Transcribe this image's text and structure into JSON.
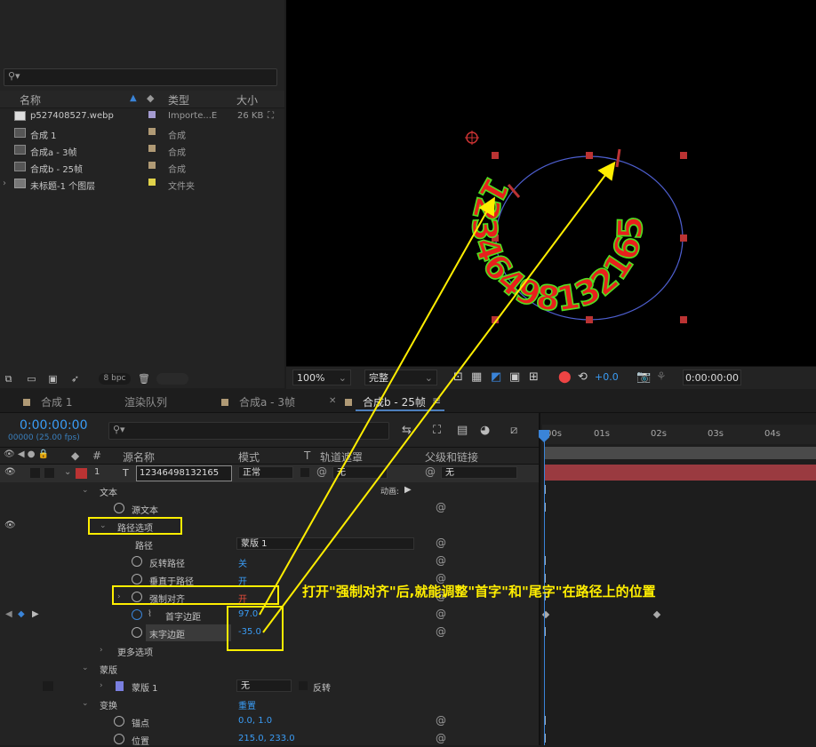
{
  "project": {
    "columns": {
      "name": "名称",
      "type": "类型",
      "size": "大小"
    },
    "items": [
      {
        "name": "p527408527.webp",
        "type": "Importe...E",
        "size": "26 KB",
        "swatch": "#a49bd0"
      },
      {
        "name": "合成 1",
        "type": "合成",
        "size": "",
        "swatch": "#b09a75"
      },
      {
        "name": "合成a - 3帧",
        "type": "合成",
        "size": "",
        "swatch": "#b09a75"
      },
      {
        "name": "合成b - 25帧",
        "type": "合成",
        "size": "",
        "swatch": "#b09a75"
      },
      {
        "name": "未标题-1 个图层",
        "type": "文件夹",
        "size": "",
        "swatch": "#e0d24a"
      }
    ],
    "bpc": "8 bpc"
  },
  "viewer": {
    "path_text": "12346498132165",
    "zoom": "100%",
    "quality": "完整",
    "exposure": "+0.0",
    "timecode": "0:00:00:00"
  },
  "tabs": [
    {
      "label": "合成 1"
    },
    {
      "label": "渲染队列"
    },
    {
      "label": "合成a - 3帧"
    },
    {
      "label": "合成b - 25帧"
    }
  ],
  "timeline": {
    "timecode": "0:00:00:00",
    "fps": "00000 (25.00 fps)",
    "columns": {
      "num": "#",
      "source": "源名称",
      "mode": "模式",
      "t": "T",
      "track": "轨道遮罩",
      "parent": "父级和链接"
    },
    "layer": {
      "num": "1",
      "name": "12346498132165",
      "mode": "正常",
      "track": "无",
      "parent": "无"
    },
    "ruler": [
      "00s",
      "01s",
      "02s",
      "03s",
      "04s"
    ],
    "rows": {
      "text": "文本",
      "animate": "动画:",
      "source_text": "源文本",
      "path_options": "路径选项",
      "path": "路径",
      "path_value": "蒙版 1",
      "reverse": "反转路径",
      "reverse_value": "关",
      "perpendicular": "垂直于路径",
      "perpendicular_value": "开",
      "force_align": "强制对齐",
      "force_align_value": "开",
      "first_margin": "首字边距",
      "first_margin_value": "97.0",
      "last_margin": "末字边距",
      "last_margin_value": "-35.0",
      "more_options": "更多选项",
      "masks": "蒙版",
      "mask1": "蒙版 1",
      "mask1_mode": "无",
      "inverted": "反转",
      "transform": "变换",
      "reset": "重置",
      "anchor": "锚点",
      "anchor_value": "0.0, 1.0",
      "position": "位置",
      "position_value": "215.0, 233.0"
    }
  },
  "annotation": "打开\"强制对齐\"后,就能调整\"首字\"和\"尾字\"在路径上的位置",
  "colors": {
    "accent": "#3a9cf5",
    "annotation": "#ffee00",
    "layer_bar": "#9a3a40",
    "path_text": "#e8201c",
    "path_stroke": "#52e020"
  }
}
